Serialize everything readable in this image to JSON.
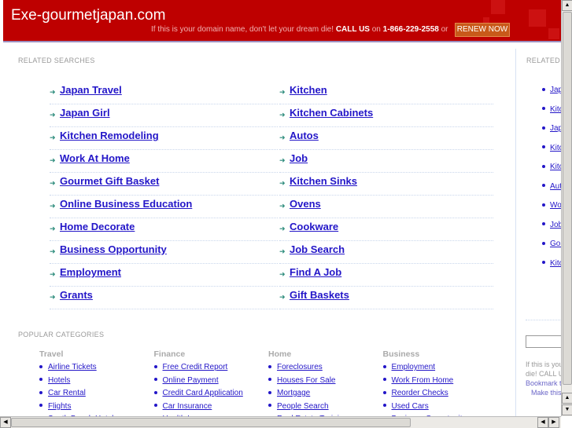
{
  "header": {
    "title": "Exe-gourmetjapan.com",
    "promo_text": "If this is your domain name, don't let your dream die!",
    "call_us": "CALL US",
    "on": "on",
    "phone": "1-866-229-2558",
    "or": "or",
    "renew_button": "RENEW NOW",
    "brand_color": "#be0000"
  },
  "related": {
    "heading": "RELATED SEARCHES",
    "left": [
      "Japan Travel",
      "Japan Girl",
      "Kitchen Remodeling",
      "Work At Home",
      "Gourmet Gift Basket",
      "Online Business Education",
      "Home Decorate",
      "Business Opportunity",
      "Employment",
      "Grants"
    ],
    "right": [
      "Kitchen",
      "Kitchen Cabinets",
      "Autos",
      "Job",
      "Kitchen Sinks",
      "Ovens",
      "Cookware",
      "Job Search",
      "Find A Job",
      "Gift Baskets"
    ]
  },
  "popular": {
    "heading": "POPULAR CATEGORIES",
    "columns": [
      {
        "title": "Travel",
        "items": [
          "Airline Tickets",
          "Hotels",
          "Car Rental",
          "Flights",
          "South Beach Hotels"
        ]
      },
      {
        "title": "Finance",
        "items": [
          "Free Credit Report",
          "Online Payment",
          "Credit Card Application",
          "Car Insurance",
          "Health Insurance"
        ]
      },
      {
        "title": "Home",
        "items": [
          "Foreclosures",
          "Houses For Sale",
          "Mortgage",
          "People Search",
          "Real Estate Training"
        ]
      },
      {
        "title": "Business",
        "items": [
          "Employment",
          "Work From Home",
          "Reorder Checks",
          "Used Cars",
          "Business Opportunity"
        ]
      }
    ]
  },
  "sidebar": {
    "heading": "RELATED SEARCHES",
    "items": [
      "Japan Travel",
      "Kitchen",
      "Japan Girl",
      "Kitchen Cabinets",
      "Kitchen Remodeling",
      "Autos",
      "Work At Home",
      "Job",
      "Gourmet Gift Basket",
      "Kitchen Sinks"
    ],
    "search_value": "",
    "note_line1": "If this is your domain name, don't let your dream",
    "note_line2": "die! CALL US",
    "bookmark": "Bookmark this page",
    "make_home": "Make this your homepage"
  }
}
